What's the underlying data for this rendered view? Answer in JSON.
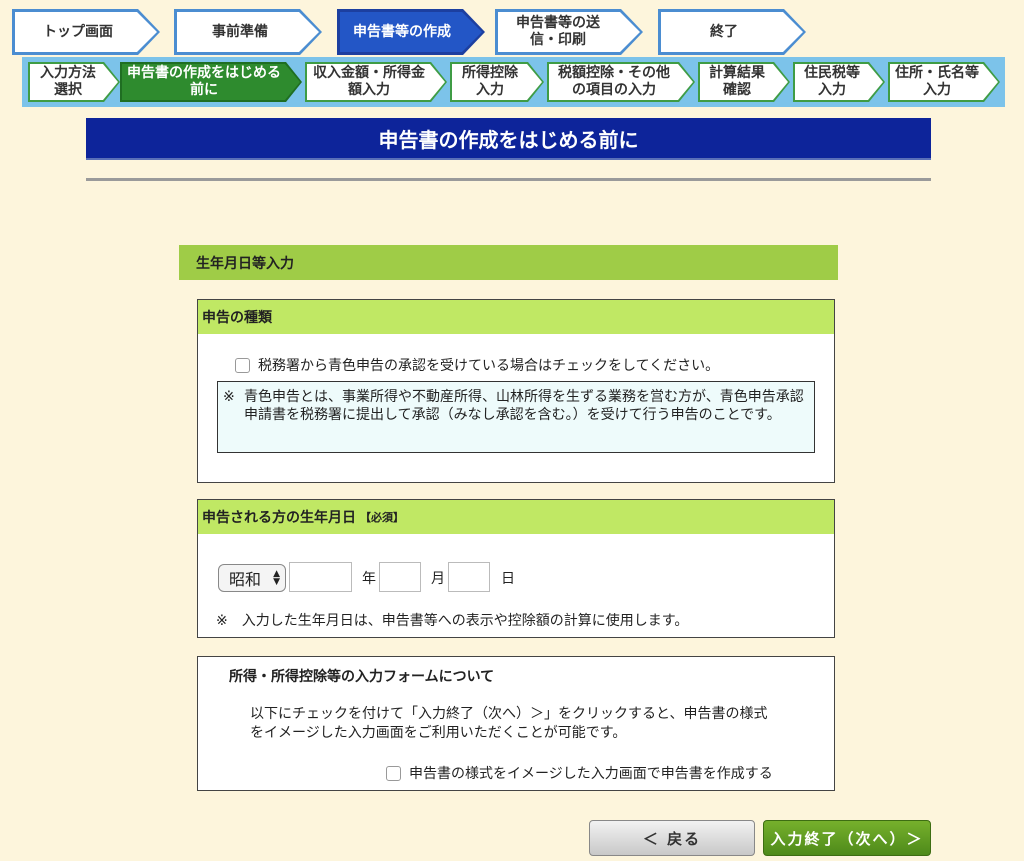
{
  "top_steps": [
    {
      "label": "トップ画面"
    },
    {
      "label": "事前準備"
    },
    {
      "label": "申告書等の作成",
      "active": true
    },
    {
      "label": "申告書等の送信・印刷"
    },
    {
      "label": "終了"
    }
  ],
  "sub_steps": [
    {
      "label": "入力方法選択"
    },
    {
      "label": "申告書の作成をはじめる前に",
      "active": true
    },
    {
      "label": "収入金額・所得金額入力"
    },
    {
      "label": "所得控除入力"
    },
    {
      "label": "税額控除・その他の項目の入力"
    },
    {
      "label": "計算結果確認"
    },
    {
      "label": "住民税等入力"
    },
    {
      "label": "住所・氏名等入力"
    }
  ],
  "page_title": "申告書の作成をはじめる前に",
  "section_header": "生年月日等入力",
  "declaration_type": {
    "heading": "申告の種類",
    "checkbox_label": "税務署から青色申告の承認を受けている場合はチェックをしてください。",
    "note_mark": "※",
    "note_text": "青色申告とは、事業所得や不動産所得、山林所得を生ずる業務を営む方が、青色申告承認申請書を税務署に提出して承認（みなし承認を含む。）を受けて行う申告のことです。"
  },
  "birthdate": {
    "heading": "申告される方の生年月日",
    "required": "【必須】",
    "era_selected": "昭和",
    "year_value": "",
    "month_value": "",
    "day_value": "",
    "year_unit": "年",
    "month_unit": "月",
    "day_unit": "日",
    "note": "※　入力した生年月日は、申告書等への表示や控除額の計算に使用します。"
  },
  "input_form": {
    "heading": "所得・所得控除等の入力フォームについて",
    "text": "以下にチェックを付けて「入力終了（次へ）＞」をクリックすると、申告書の様式をイメージした入力画面をご利用いただくことが可能です。",
    "checkbox_label": "申告書の様式をイメージした入力画面で申告書を作成する"
  },
  "buttons": {
    "back": "＜ 戻る",
    "next": "入力終了（次へ）＞"
  }
}
